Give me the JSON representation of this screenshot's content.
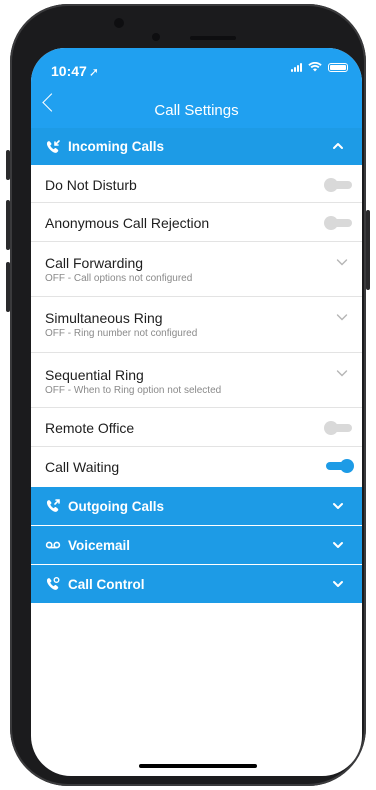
{
  "status_bar": {
    "time": "10:47",
    "location_arrow": "location-arrow-icon"
  },
  "nav": {
    "title": "Call Settings"
  },
  "sections": {
    "incoming": {
      "title": "Incoming Calls",
      "rows": {
        "dnd": {
          "label": "Do Not Disturb",
          "enabled": false
        },
        "acr": {
          "label": "Anonymous Call Rejection",
          "enabled": false
        },
        "forwarding": {
          "label": "Call Forwarding",
          "sub": "OFF - Call options not configured"
        },
        "simring": {
          "label": "Simultaneous Ring",
          "sub": "OFF - Ring number not configured"
        },
        "seqring": {
          "label": "Sequential Ring",
          "sub": "OFF - When to Ring option not selected"
        },
        "remote": {
          "label": "Remote Office",
          "enabled": false
        },
        "waiting": {
          "label": "Call Waiting",
          "enabled": true
        }
      }
    },
    "outgoing": {
      "title": "Outgoing Calls"
    },
    "voicemail": {
      "title": "Voicemail"
    },
    "control": {
      "title": "Call Control"
    }
  },
  "colors": {
    "accent": "#1d9be6",
    "header": "#20a0f0",
    "toggle_off": "#d9d9d9"
  }
}
